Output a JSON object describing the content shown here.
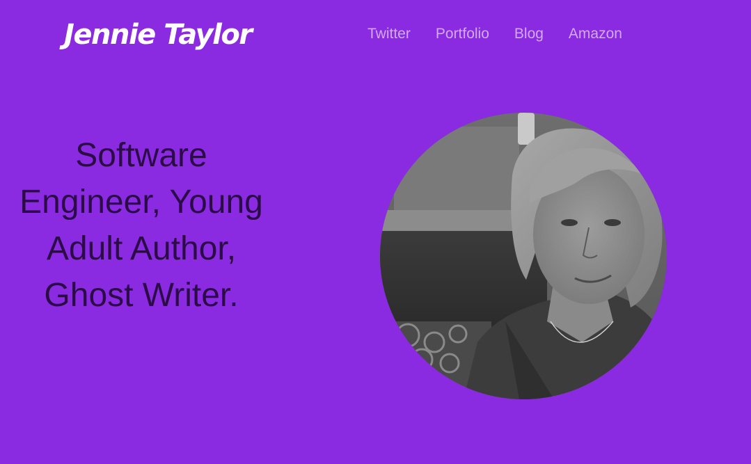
{
  "header": {
    "site_title": "Jennie Taylor"
  },
  "nav": {
    "items": [
      {
        "label": "Twitter"
      },
      {
        "label": "Portfolio"
      },
      {
        "label": "Blog"
      },
      {
        "label": "Amazon"
      }
    ]
  },
  "hero": {
    "tagline": "Software Engineer, Young Adult Author, Ghost Writer."
  },
  "colors": {
    "background": "#8a2be2",
    "title": "#ffffff",
    "nav_link": "#d3a9f2",
    "tagline": "#2c0c47"
  }
}
